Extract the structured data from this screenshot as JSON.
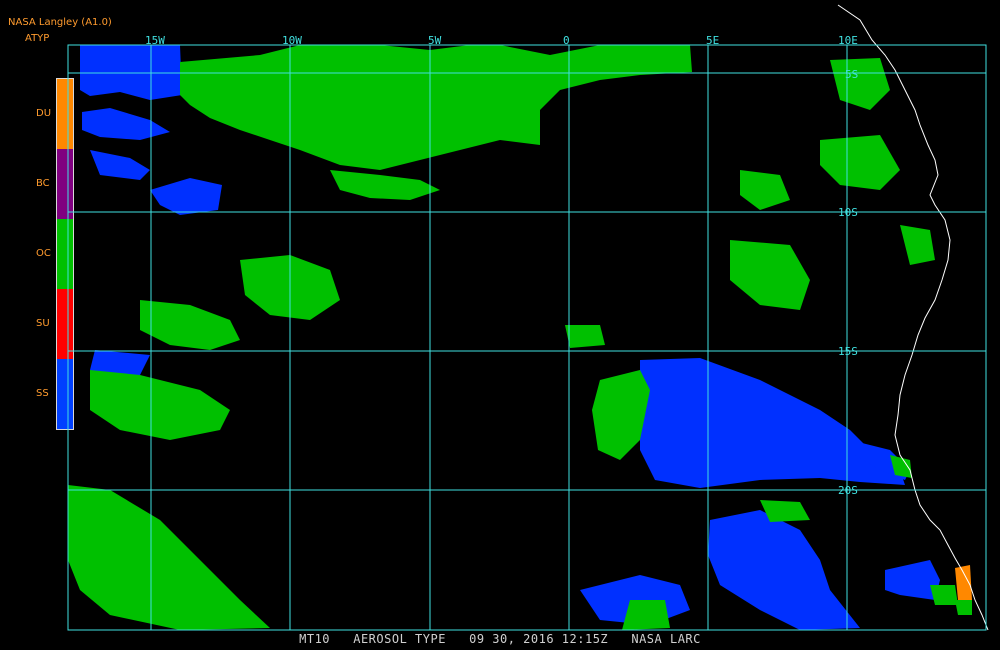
{
  "header": {
    "title": "NASA Langley (A1.0)",
    "product": "ATYP"
  },
  "legend": [
    {
      "code": "DU",
      "color": "#ff8800"
    },
    {
      "code": "BC",
      "color": "#800080"
    },
    {
      "code": "OC",
      "color": "#00c000"
    },
    {
      "code": "SU",
      "color": "#ff0000"
    },
    {
      "code": "SS",
      "color": "#0040ff"
    }
  ],
  "map": {
    "lon_labels": [
      "15W",
      "10W",
      "5W",
      "0",
      "5E",
      "10E"
    ],
    "lat_labels": [
      "5S",
      "10S",
      "15S",
      "20S"
    ],
    "grid_color": "#40e0e0",
    "coast_color": "#ffffff",
    "background": "#000000"
  },
  "footer": {
    "satellite": "MT10",
    "product_name": "AEROSOL TYPE",
    "datetime": "09 30, 2016 12:15Z",
    "agency": "NASA LARC"
  }
}
